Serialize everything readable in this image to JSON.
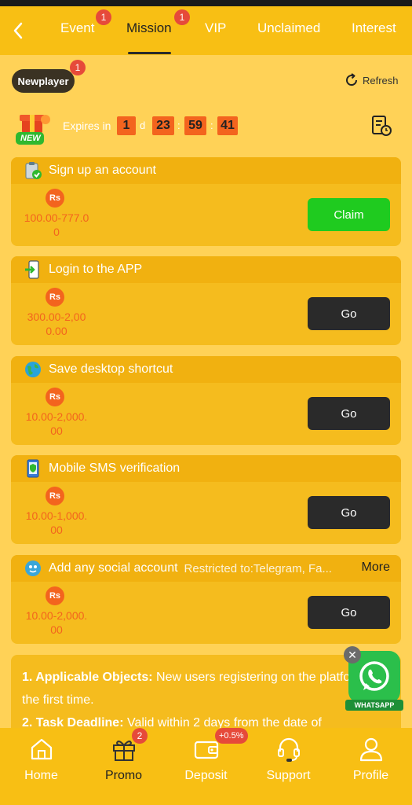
{
  "nav": {
    "tabs": [
      {
        "label": "Event",
        "badge": "1"
      },
      {
        "label": "Mission",
        "badge": "1"
      },
      {
        "label": "VIP"
      },
      {
        "label": "Unclaimed"
      },
      {
        "label": "Interest"
      }
    ],
    "active_tab": "Mission"
  },
  "newplayer": {
    "label": "Newplayer",
    "badge": "1"
  },
  "refresh_label": "Refresh",
  "expires": {
    "label": "Expires in",
    "days": "1",
    "day_unit": "d",
    "hours": "23",
    "minutes": "59",
    "seconds": "41",
    "new_tag": "NEW"
  },
  "missions": [
    {
      "icon": "clipboard-check-icon",
      "title": "Sign up an account",
      "currency": "Rs",
      "amount": "100.00-777.00",
      "action": "Claim"
    },
    {
      "icon": "phone-login-icon",
      "title": "Login to the APP",
      "currency": "Rs",
      "amount": "300.00-2,000.00",
      "action": "Go"
    },
    {
      "icon": "globe-icon",
      "title": "Save desktop shortcut",
      "currency": "Rs",
      "amount": "10.00-2,000.00",
      "action": "Go"
    },
    {
      "icon": "mobile-shield-icon",
      "title": "Mobile SMS verification",
      "currency": "Rs",
      "amount": "10.00-1,000.00",
      "action": "Go"
    },
    {
      "icon": "social-bird-icon",
      "title": "Add any social account",
      "subtitle": "Restricted to:Telegram, Fa...",
      "more": "More",
      "currency": "Rs",
      "amount": "10.00-2,000.00",
      "action": "Go"
    }
  ],
  "rules": {
    "item1_title": "1. Applicable Objects:",
    "item1_text": " New users registering on the platform for the first time.",
    "item2_title": "2. Task Deadline:",
    "item2_text": " Valid within 2 days from the date of"
  },
  "whatsapp": {
    "label": "WHATSAPP",
    "close": "✕"
  },
  "bottom_nav": [
    {
      "label": "Home"
    },
    {
      "label": "Promo",
      "badge": "2"
    },
    {
      "label": "Deposit",
      "badge": "+0.5%"
    },
    {
      "label": "Support"
    },
    {
      "label": "Profile"
    }
  ],
  "colors": {
    "primary": "#f8bf14",
    "accent": "#f3641e",
    "claim": "#1fcb1f",
    "dark": "#2a2a2a"
  }
}
